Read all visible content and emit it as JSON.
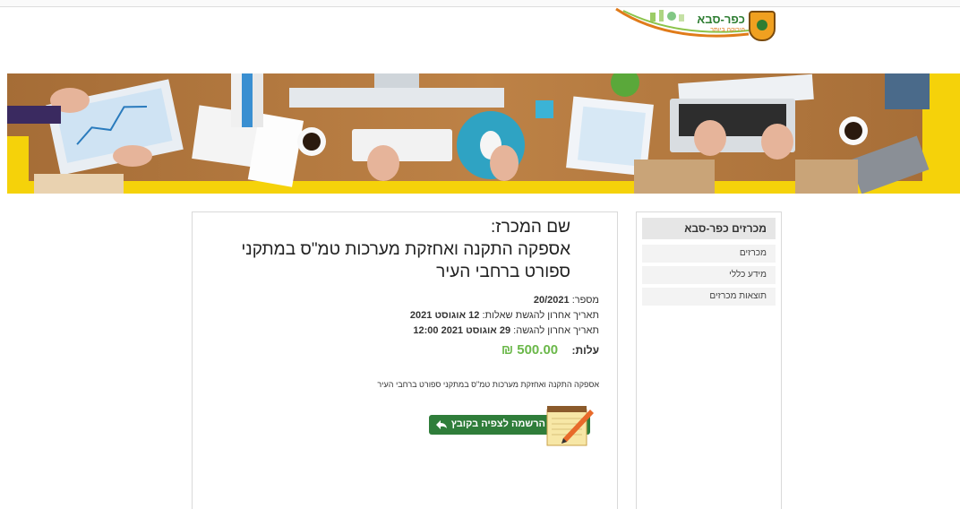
{
  "header": {
    "logo_text": "כפר-סבא",
    "logo_sub": "הירוקה ביותר"
  },
  "sidebar": {
    "title": "מכרזים כפר-סבא",
    "items": [
      {
        "label": "מכרזים"
      },
      {
        "label": "מידע כללי"
      },
      {
        "label": "תוצאות מכרזים"
      }
    ]
  },
  "tender": {
    "name_label": "שם המכרז:",
    "title_line1": "אספקה התקנה ואחזקת מערכות טמ\"ס במתקני",
    "title_line2": "ספורט ברחבי העיר",
    "number_label": "מספר:",
    "number_value": "20/2021",
    "questions_label": "תאריך אחרון להגשת שאלות:",
    "questions_value": "12 אוגוסט 2021",
    "submit_label": "תאריך אחרון להגשה:",
    "submit_value": "29 אוגוסט 2021 12:00",
    "cost_label": "עלות:",
    "cost_value": "500.00 ₪",
    "description": "אספקה התקנה ואחזקת מערכות טמ\"ס במתקני ספורט ברחבי העיר",
    "register_label": "הרשמה לצפיה בקובץ"
  },
  "icons": {
    "logo": "city-seal-icon",
    "register_arrow": "reply-arrow-icon",
    "register_pad": "notepad-pencil-icon"
  },
  "colors": {
    "accent_green": "#2f7d3a",
    "price_green": "#6bb84a",
    "banner_yellow": "#f5d20a"
  }
}
